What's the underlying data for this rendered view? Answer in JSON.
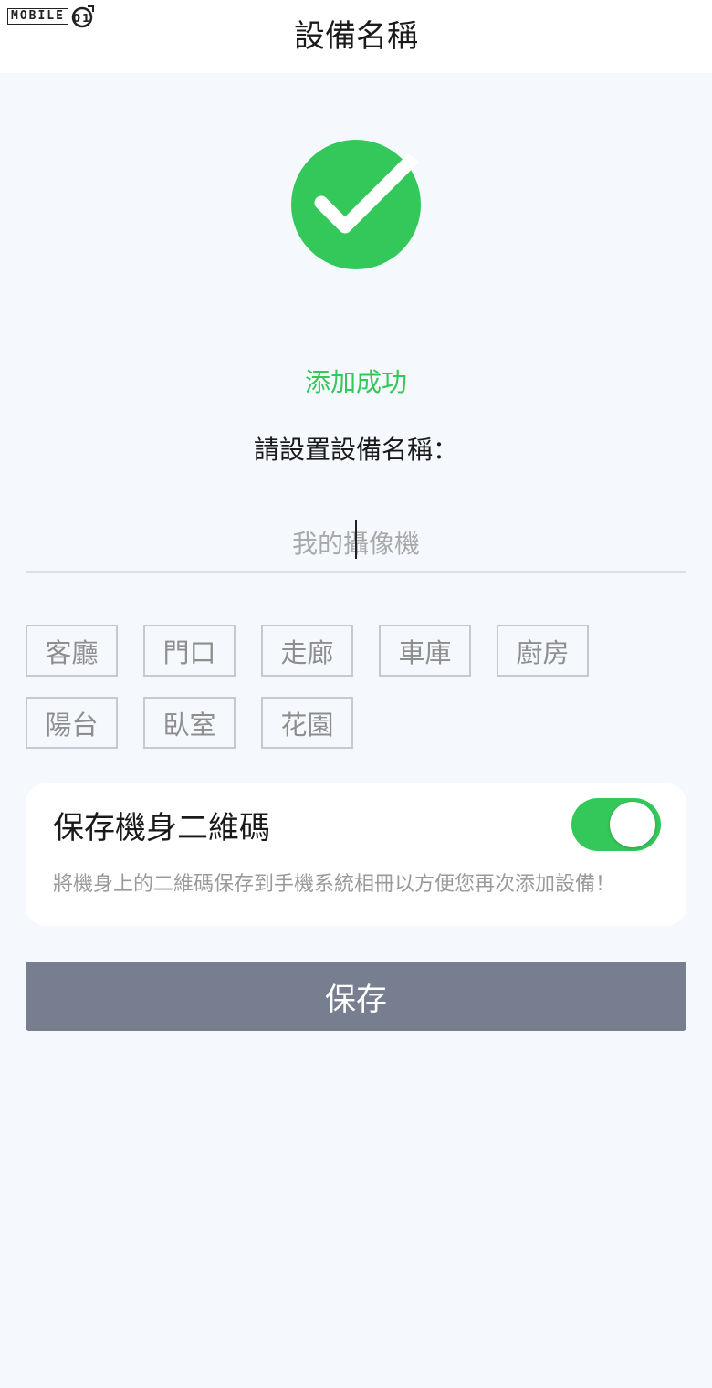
{
  "watermark": {
    "text": "MOBILE",
    "icon": "mobile01-logo-icon"
  },
  "header": {
    "title": "設備名稱"
  },
  "status": {
    "icon": "check-circle-icon",
    "message": "添加成功",
    "color": "#34c759"
  },
  "form": {
    "prompt": "請設置設備名稱：",
    "name_input": {
      "value": "",
      "placeholder": "我的攝像機"
    }
  },
  "tags": [
    "客廳",
    "門口",
    "走廊",
    "車庫",
    "廚房",
    "陽台",
    "臥室",
    "花園"
  ],
  "qr_option": {
    "title": "保存機身二維碼",
    "enabled": true,
    "description": "將機身上的二維碼保存到手機系統相冊以方便您再次添加設備！"
  },
  "actions": {
    "save_label": "保存",
    "save_color": "#767e8f"
  }
}
